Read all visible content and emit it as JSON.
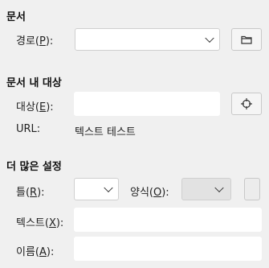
{
  "sections": {
    "document": {
      "title": "문서",
      "path": {
        "label_pre": "경로(",
        "label_key": "P",
        "label_post": "):",
        "value": ""
      }
    },
    "target": {
      "title": "문서 내 대상",
      "target": {
        "label_pre": "대상(",
        "label_key": "E",
        "label_post": "):",
        "value": ""
      },
      "url": {
        "label": "URL:",
        "value": "텍스트 테스트"
      }
    },
    "more": {
      "title": "더 많은 설정",
      "frame": {
        "label_pre": "틀(",
        "label_key": "R",
        "label_post": "):",
        "value": ""
      },
      "form": {
        "label_pre": "양식(",
        "label_key": "O",
        "label_post": "):",
        "value": ""
      },
      "text": {
        "label_pre": "텍스트(",
        "label_key": "X",
        "label_post": "):",
        "value": ""
      },
      "name": {
        "label_pre": "이름(",
        "label_key": "A",
        "label_post": "):",
        "value": ""
      }
    }
  },
  "icons": {
    "open_file": "folder-icon",
    "target_select": "crosshair-icon",
    "path_dropdown": "chevron-down-icon"
  },
  "colors": {
    "panel_bg": "#f0f0f0",
    "field_bg": "#ffffff",
    "border": "#cfcfcf"
  }
}
